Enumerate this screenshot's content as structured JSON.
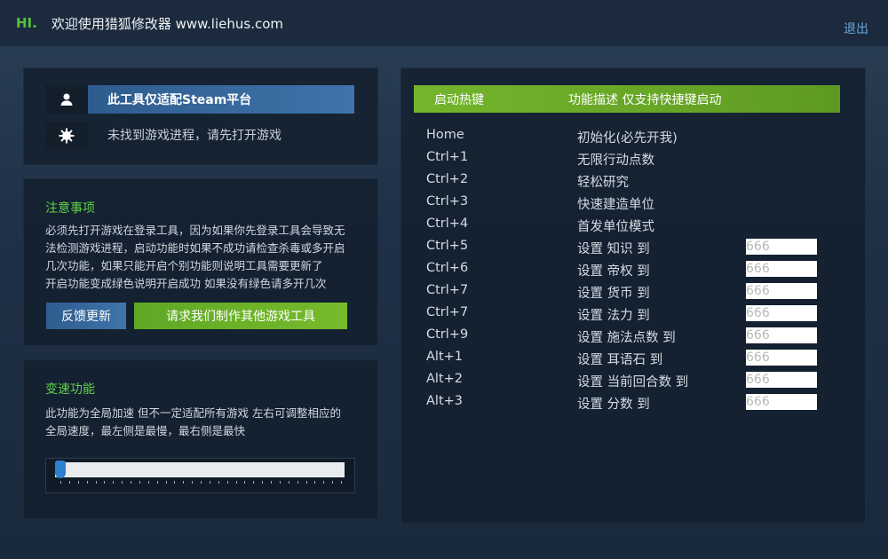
{
  "titlebar": {
    "hi": "HI.",
    "welcome": "欢迎使用猎狐修改器 www.liehus.com",
    "logout": "退出"
  },
  "status_panel": {
    "platform_label": "此工具仅适配Steam平台",
    "process_status": "未找到游戏进程，请先打开游戏",
    "user_icon": "user-icon",
    "gear_icon": "gear-icon"
  },
  "notes": {
    "title": "注意事项",
    "lines": [
      "必须先打开游戏在登录工具，因为如果你先登录工具会导致无",
      "法检测游戏进程，启动功能时如果不成功请检查杀毒或多开启",
      "几次功能，如果只能开启个别功能则说明工具需要更新了",
      "开启功能变成绿色说明开启成功 如果没有绿色请多开几次"
    ],
    "feedback_button": "反馈更新",
    "request_button": "请求我们制作其他游戏工具"
  },
  "speed": {
    "title": "变速功能",
    "lines": [
      "此功能为全局加速 但不一定适配所有游戏 左右可调整相应的",
      "全局速度，最左侧是最慢，最右侧是最快"
    ],
    "slider_value": 0
  },
  "hotkeys": {
    "header_key": "启动热键",
    "header_desc": "功能描述 仅支持快捷键启动",
    "rows": [
      {
        "key": "Home",
        "desc": "初始化(必先开我)"
      },
      {
        "key": "Ctrl+1",
        "desc": "无限行动点数"
      },
      {
        "key": "Ctrl+2",
        "desc": "轻松研究"
      },
      {
        "key": "Ctrl+3",
        "desc": "快速建造单位"
      },
      {
        "key": "Ctrl+4",
        "desc": "首发单位模式"
      },
      {
        "key": "Ctrl+5",
        "desc": "设置 知识 到",
        "placeholder": "666"
      },
      {
        "key": "Ctrl+6",
        "desc": "设置 帝权 到",
        "placeholder": "666"
      },
      {
        "key": "Ctrl+7",
        "desc": "设置 货币 到",
        "placeholder": "666"
      },
      {
        "key": "Ctrl+7",
        "desc": "设置 法力 到",
        "placeholder": "666"
      },
      {
        "key": "Ctrl+9",
        "desc": "设置 施法点数 到",
        "placeholder": "666"
      },
      {
        "key": "Alt+1",
        "desc": "设置 耳语石 到",
        "placeholder": "666"
      },
      {
        "key": "Alt+2",
        "desc": "设置 当前回合数 到",
        "placeholder": "666"
      },
      {
        "key": "Alt+3",
        "desc": "设置 分数 到",
        "placeholder": "666"
      }
    ]
  }
}
